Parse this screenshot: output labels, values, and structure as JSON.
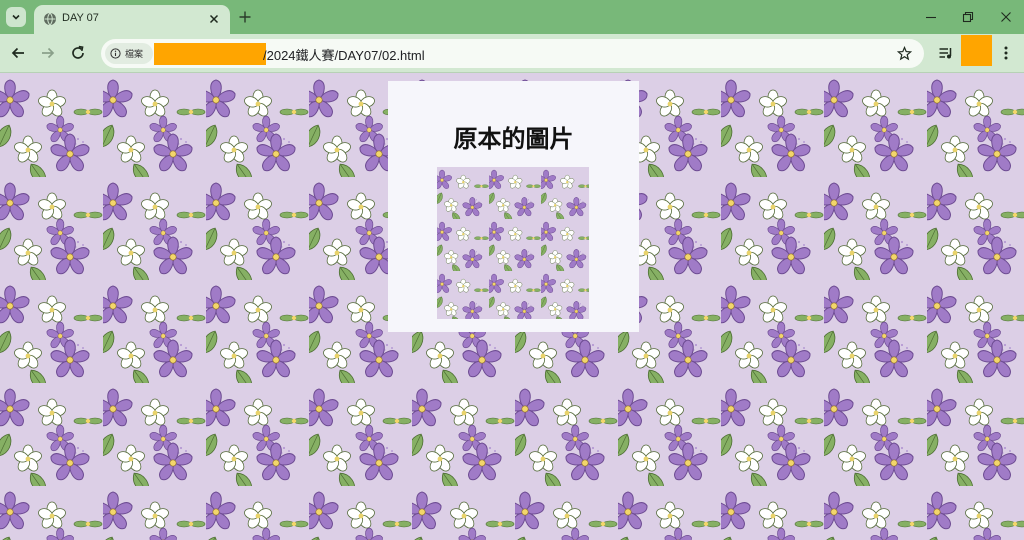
{
  "browser": {
    "tab_title": "DAY 07",
    "site_chip_label": "檔案",
    "url_visible": "/2024鐵人賽/DAY07/02.html"
  },
  "page": {
    "card_title": "原本的圖片"
  },
  "colors": {
    "tabbar": "#78b879",
    "toolbar": "#d2e8d1",
    "background": "#dccfe6",
    "petal_purple": "#9b6fc0",
    "leaf_green": "#7aa55a",
    "redaction": "#ffa500"
  },
  "icons": {
    "tab_search": "chevron-down-icon",
    "favicon": "globe-icon",
    "tab_close": "close-icon",
    "new_tab": "plus-icon",
    "back": "arrow-left-icon",
    "forward": "arrow-right-icon",
    "reload": "reload-icon",
    "site_info": "info-icon",
    "bookmark": "star-icon",
    "media": "media-queue-icon",
    "menu": "kebab-menu-icon",
    "minimize": "minimize-icon",
    "restore": "restore-icon",
    "close_window": "close-icon"
  }
}
